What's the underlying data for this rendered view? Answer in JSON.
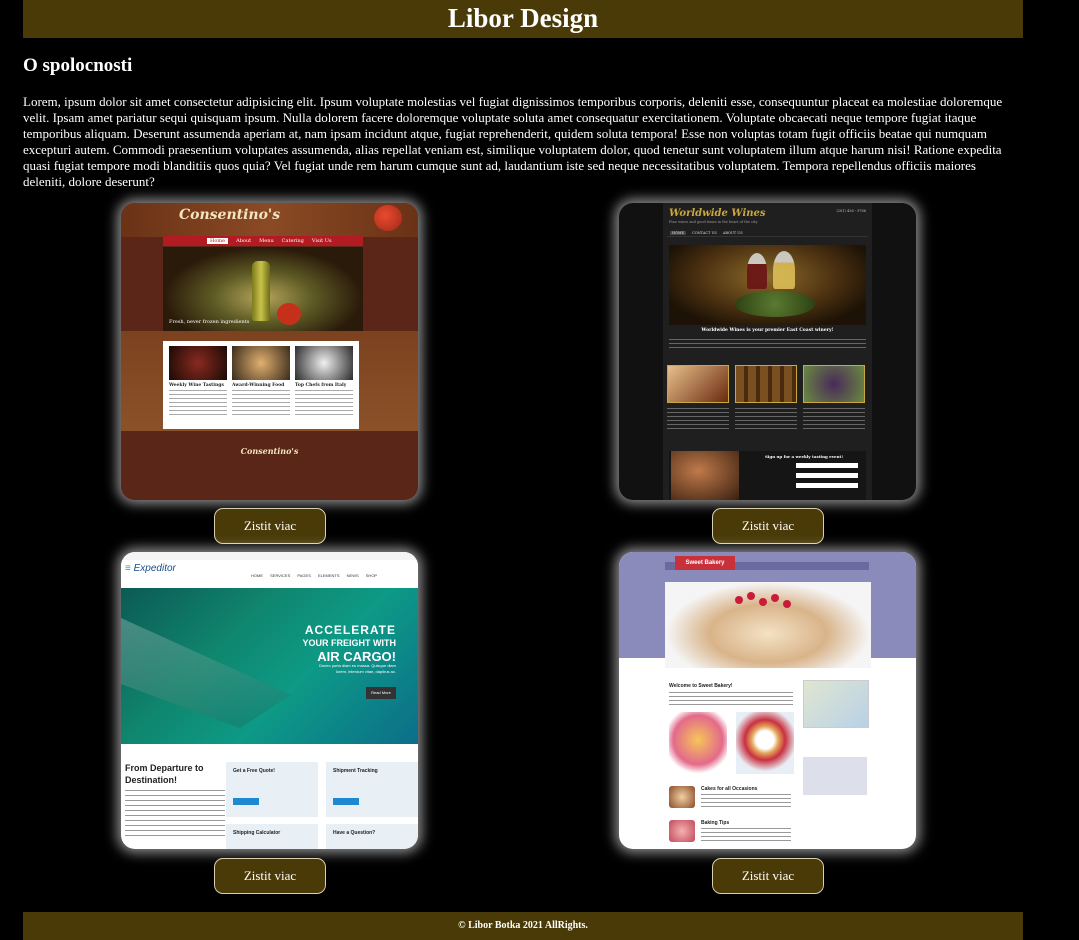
{
  "header": {
    "title": "Libor Design"
  },
  "about": {
    "heading": "O spolocnosti",
    "text": "Lorem, ipsum dolor sit amet consectetur adipisicing elit. Ipsum voluptate molestias vel fugiat dignissimos temporibus corporis, deleniti esse, consequuntur placeat ea molestiae doloremque velit. Ipsam amet pariatur sequi quisquam ipsum. Nulla dolorem facere doloremque voluptate soluta amet consequatur exercitationem. Voluptate obcaecati neque tempore fugiat itaque temporibus aliquam. Deserunt assumenda aperiam at, nam ipsam incidunt atque, fugiat reprehenderit, quidem soluta tempora! Esse non voluptas totam fugit officiis beatae qui numquam excepturi autem. Commodi praesentium voluptates assumenda, alias repellat veniam est, similique voluptatem dolor, quod tenetur sunt voluptatem illum atque harum nisi! Ratione expedita quasi fugiat tempore modi blanditiis quos quia? Vel fugiat unde rem harum cumque sunt ad, laudantium iste sed neque necessitatibus voluptatem. Tempora repellendus officiis maiores deleniti, dolore deserunt?"
  },
  "projects": [
    {
      "button_label": "Zistit viac",
      "thumb": {
        "logo": "Consentino's",
        "nav": [
          "Home",
          "About",
          "Menu",
          "Catering",
          "Visit Us"
        ],
        "tagline": "Fresh, never frozen ingredients",
        "features": [
          "Weekly Wine Tastings",
          "Award-Winning Food",
          "Top Chefs from Italy"
        ],
        "footer_logo": "Consentino's"
      }
    },
    {
      "button_label": "Zistit viac",
      "thumb": {
        "logo": "Worldwide Wines",
        "subtitle": "Fine wines and good times in the heart of the city",
        "phone": "(281) 436 - 9786",
        "nav": [
          "HOME",
          "CONTACT US",
          "ABOUT US"
        ],
        "headline": "Worldwide Wines is your premier East Coast winery!",
        "signup": "Sign up for a weekly tasting event!"
      }
    },
    {
      "button_label": "Zistit viac",
      "thumb": {
        "logo_a": "Expe",
        "logo_b": "ditor",
        "menu": "HOME SERVICES PAGES ELEMENTS NEWS SHOP",
        "hero_1": "ACCELERATE",
        "hero_2": "YOUR FREIGHT WITH",
        "hero_3": "AIR CARGO!",
        "hero_4": "Donec porta diam eu massa. Quisque diam lorem, interdum vitae, dapibus ac.",
        "read_more": "Read More",
        "section": "From Departure to Destination!",
        "boxes": [
          "Get a Free Quote!",
          "Shipment Tracking",
          "Shipping Calculator",
          "Have a Question?"
        ]
      }
    },
    {
      "button_label": "Zistit viac",
      "thumb": {
        "logo": "Sweet Bakery",
        "welcome": "Welcome to Sweet Bakery!",
        "rows": [
          "Cakes for all Occasions",
          "Baking Tips"
        ]
      }
    }
  ],
  "footer": {
    "text": "© Libor Botka 2021 AllRights."
  }
}
